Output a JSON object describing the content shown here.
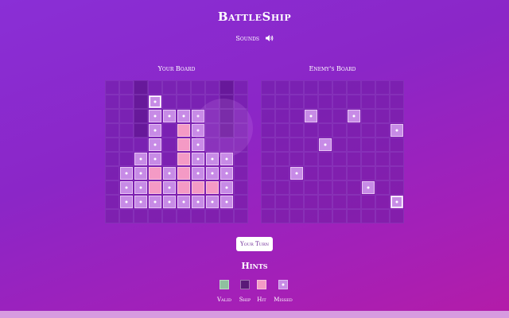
{
  "game": {
    "title": "BattleShip",
    "sounds_label": "Sounds",
    "turn_label": "Your Turn"
  },
  "player_board": {
    "label": "Your Board",
    "size": 10,
    "ships": [
      [
        1,
        3
      ],
      [
        2,
        3
      ],
      [
        2,
        4
      ],
      [
        2,
        5
      ],
      [
        2,
        6
      ],
      [
        3,
        3
      ],
      [
        3,
        6
      ],
      [
        4,
        3
      ],
      [
        4,
        6
      ],
      [
        5,
        2
      ],
      [
        5,
        3
      ],
      [
        5,
        6
      ],
      [
        5,
        7
      ],
      [
        5,
        8
      ],
      [
        6,
        1
      ],
      [
        6,
        2
      ],
      [
        6,
        3
      ],
      [
        6,
        4
      ],
      [
        6,
        5
      ],
      [
        6,
        6
      ],
      [
        6,
        7
      ],
      [
        6,
        8
      ],
      [
        7,
        1
      ],
      [
        7,
        2
      ],
      [
        7,
        3
      ],
      [
        7,
        4
      ],
      [
        7,
        5
      ],
      [
        7,
        6
      ],
      [
        7,
        7
      ],
      [
        7,
        8
      ],
      [
        8,
        1
      ],
      [
        8,
        2
      ],
      [
        8,
        3
      ],
      [
        8,
        4
      ],
      [
        8,
        5
      ],
      [
        8,
        6
      ],
      [
        8,
        7
      ],
      [
        8,
        8
      ]
    ],
    "hits": [
      [
        3,
        5
      ],
      [
        4,
        5
      ],
      [
        5,
        5
      ],
      [
        6,
        3
      ],
      [
        6,
        5
      ],
      [
        7,
        3
      ],
      [
        7,
        5
      ],
      [
        7,
        6
      ],
      [
        7,
        7
      ]
    ],
    "misses": [
      [
        1,
        3
      ]
    ],
    "selected": [
      1,
      3
    ]
  },
  "enemy_board": {
    "label": "Enemy's Board",
    "size": 10,
    "misses": [
      [
        2,
        3
      ],
      [
        2,
        6
      ],
      [
        3,
        9
      ],
      [
        4,
        4
      ],
      [
        6,
        2
      ],
      [
        7,
        7
      ],
      [
        8,
        9
      ]
    ],
    "selected": [
      8,
      9
    ]
  },
  "hints": {
    "title": "Hints",
    "items": [
      {
        "label": "Valid",
        "color": "#8fbf9f",
        "dot": false
      },
      {
        "label": "Ship",
        "color": "#5a1a78",
        "dot": false
      },
      {
        "label": "Hit",
        "color": "#f49ac5",
        "dot": false
      },
      {
        "label": "Missed",
        "color": "#c78be6",
        "dot": true
      }
    ]
  },
  "colors": {
    "accent": "#8a2fd6",
    "ship": "#c78be6",
    "hit": "#f49ac5"
  }
}
